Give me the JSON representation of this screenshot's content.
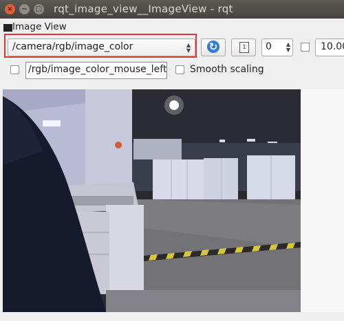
{
  "window": {
    "title": "rqt_image_view__ImageView - rqt",
    "close_glyph": "×",
    "min_glyph": "−",
    "max_glyph": "□"
  },
  "plugin": {
    "title": "Image View"
  },
  "toolbar": {
    "topic_value": "/camera/rgb/image_color",
    "rotation_value": "0",
    "num_value": "10.00",
    "refresh_glyph": "↻",
    "zoom_glyph": "1"
  },
  "mouse_topic": {
    "value": "/rgb/image_color_mouse_left",
    "checked": false
  },
  "smooth_scaling": {
    "label": "Smooth scaling",
    "checked": false
  },
  "icons": {
    "refresh": "refresh-icon",
    "zoom": "zoom-1-to-1-icon"
  },
  "colors": {
    "highlight_border": "#e53535",
    "refresh_blue": "#2f7bd7"
  }
}
